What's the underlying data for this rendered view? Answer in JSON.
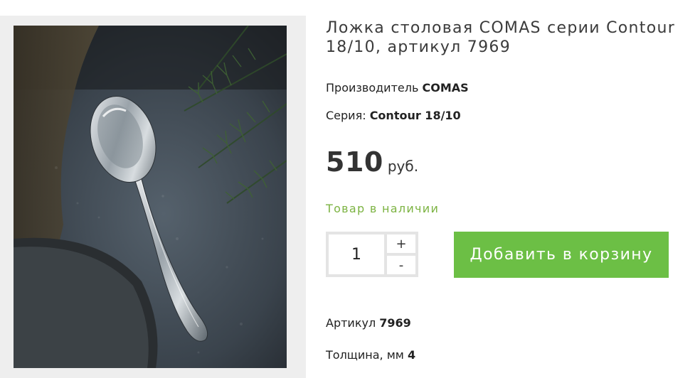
{
  "product": {
    "title": "Ложка столовая COMAS серии Contour 18/10, артикул 7969",
    "maker_label": "Производитель",
    "maker_value": "COMAS",
    "series_label": "Серия:",
    "series_value": "Contour 18/10",
    "price_amount": "510",
    "price_currency": "руб.",
    "stock_status": "Товар в наличии",
    "sku_label": "Артикул",
    "sku_value": "7969",
    "thickness_label": "Толщина, мм",
    "thickness_value": "4"
  },
  "cart": {
    "quantity": "1",
    "plus_label": "+",
    "minus_label": "-",
    "add_label": "Добавить в корзину"
  },
  "colors": {
    "accent_green": "#6cbf45",
    "stock_green": "#7cb342",
    "gallery_bg": "#eeeeee"
  }
}
